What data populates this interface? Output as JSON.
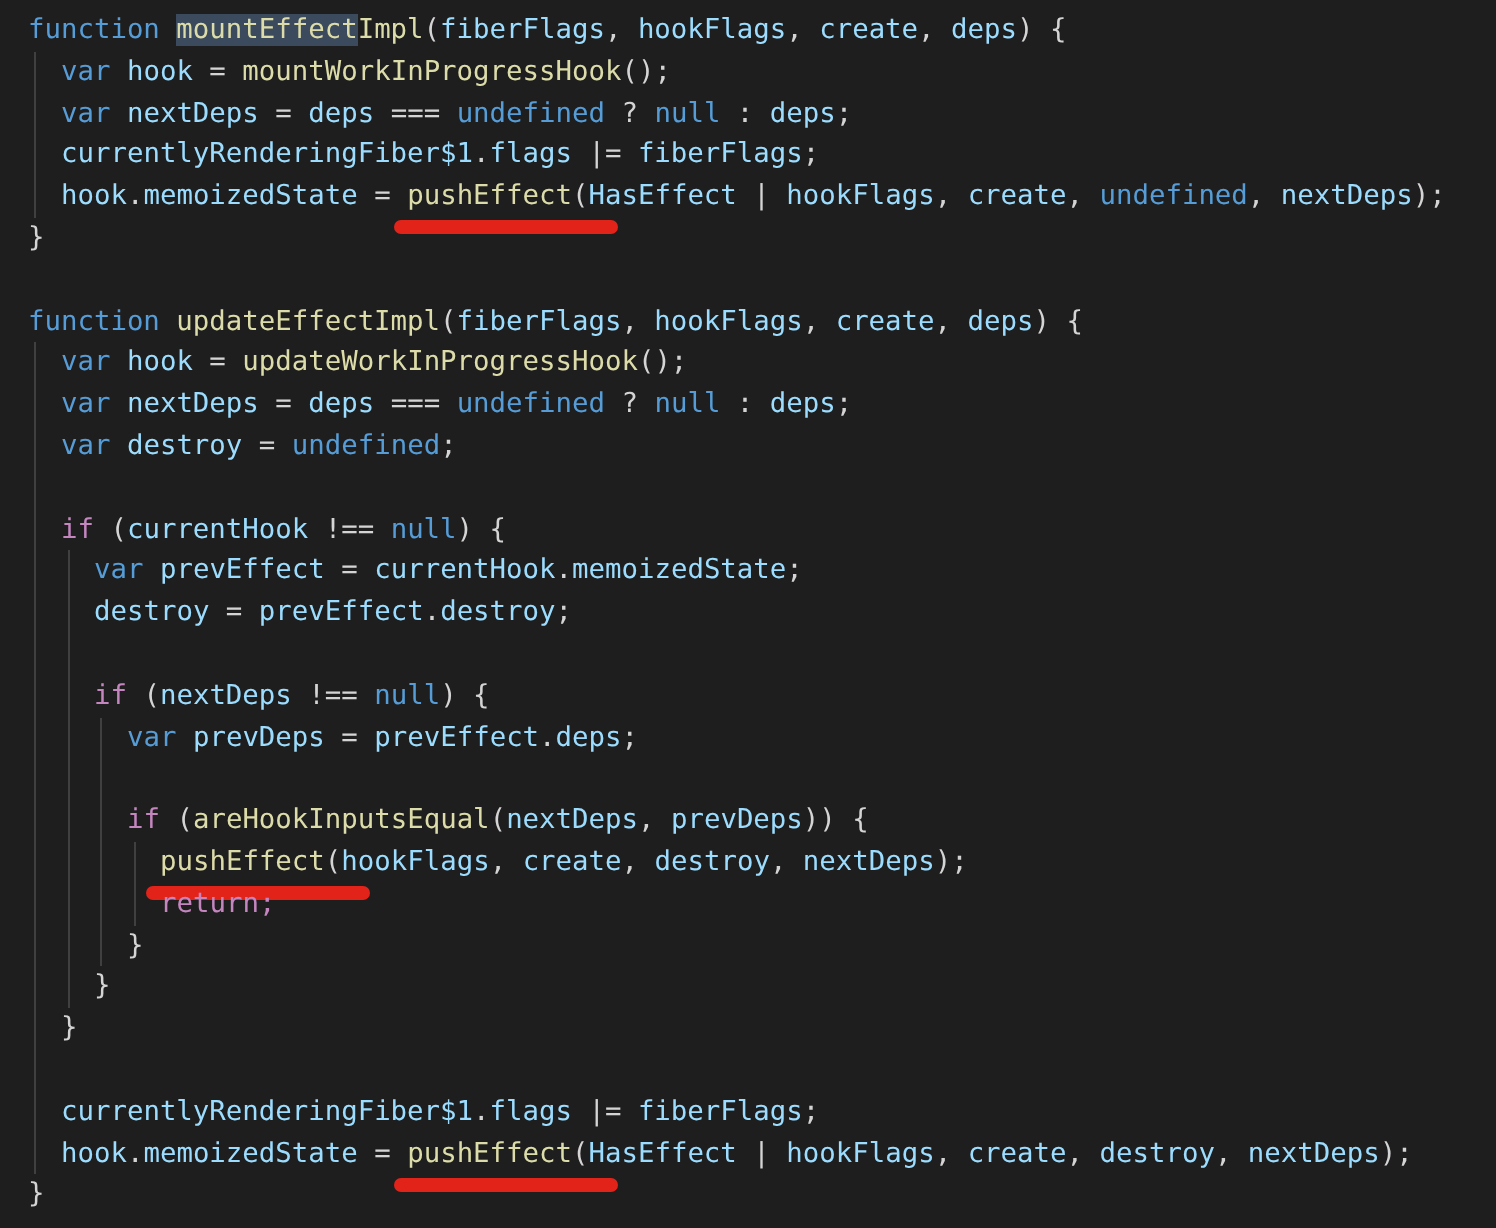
{
  "lines": [
    {
      "kind": "code",
      "tokens": [
        {
          "t": "function ",
          "kind": "kw",
          "highlighted": false,
          "underlined": false
        },
        {
          "t": "mountEffect",
          "kind": "fn",
          "highlighted": true,
          "underlined": false
        },
        {
          "t": "Impl",
          "kind": "fn",
          "highlighted": false,
          "underlined": false
        },
        {
          "t": "(",
          "kind": "op",
          "highlighted": false,
          "underlined": false
        },
        {
          "t": "fiberFlags",
          "kind": "id",
          "highlighted": false,
          "underlined": false
        },
        {
          "t": ", ",
          "kind": "op",
          "highlighted": false,
          "underlined": false
        },
        {
          "t": "hookFlags",
          "kind": "id",
          "highlighted": false,
          "underlined": false
        },
        {
          "t": ", ",
          "kind": "op",
          "highlighted": false,
          "underlined": false
        },
        {
          "t": "create",
          "kind": "id",
          "highlighted": false,
          "underlined": false
        },
        {
          "t": ", ",
          "kind": "op",
          "highlighted": false,
          "underlined": false
        },
        {
          "t": "deps",
          "kind": "id",
          "highlighted": false,
          "underlined": false
        },
        {
          "t": ") {",
          "kind": "op",
          "highlighted": false,
          "underlined": false
        }
      ],
      "children": [
        {
          "kind": "code",
          "tokens": [
            {
              "t": "var ",
              "kind": "kw",
              "highlighted": false,
              "underlined": false
            },
            {
              "t": "hook",
              "kind": "id",
              "highlighted": false,
              "underlined": false
            },
            {
              "t": " = ",
              "kind": "op",
              "highlighted": false,
              "underlined": false
            },
            {
              "t": "mountWorkInProgressHook",
              "kind": "fn",
              "highlighted": false,
              "underlined": false
            },
            {
              "t": "();",
              "kind": "op",
              "highlighted": false,
              "underlined": false
            }
          ]
        },
        {
          "kind": "code",
          "tokens": [
            {
              "t": "var ",
              "kind": "kw",
              "highlighted": false,
              "underlined": false
            },
            {
              "t": "nextDeps",
              "kind": "id",
              "highlighted": false,
              "underlined": false
            },
            {
              "t": " = ",
              "kind": "op",
              "highlighted": false,
              "underlined": false
            },
            {
              "t": "deps",
              "kind": "id",
              "highlighted": false,
              "underlined": false
            },
            {
              "t": " === ",
              "kind": "op",
              "highlighted": false,
              "underlined": false
            },
            {
              "t": "undefined",
              "kind": "kw",
              "highlighted": false,
              "underlined": false
            },
            {
              "t": " ? ",
              "kind": "op",
              "highlighted": false,
              "underlined": false
            },
            {
              "t": "null",
              "kind": "kw",
              "highlighted": false,
              "underlined": false
            },
            {
              "t": " : ",
              "kind": "op",
              "highlighted": false,
              "underlined": false
            },
            {
              "t": "deps",
              "kind": "id",
              "highlighted": false,
              "underlined": false
            },
            {
              "t": ";",
              "kind": "op",
              "highlighted": false,
              "underlined": false
            }
          ]
        },
        {
          "kind": "code",
          "tokens": [
            {
              "t": "currentlyRenderingFiber$1",
              "kind": "id",
              "highlighted": false,
              "underlined": false
            },
            {
              "t": ".",
              "kind": "op",
              "highlighted": false,
              "underlined": false
            },
            {
              "t": "flags",
              "kind": "id",
              "highlighted": false,
              "underlined": false
            },
            {
              "t": " |= ",
              "kind": "op",
              "highlighted": false,
              "underlined": false
            },
            {
              "t": "fiberFlags",
              "kind": "id",
              "highlighted": false,
              "underlined": false
            },
            {
              "t": ";",
              "kind": "op",
              "highlighted": false,
              "underlined": false
            }
          ]
        },
        {
          "kind": "code",
          "tokens": [
            {
              "t": "hook",
              "kind": "id",
              "highlighted": false,
              "underlined": false
            },
            {
              "t": ".",
              "kind": "op",
              "highlighted": false,
              "underlined": false
            },
            {
              "t": "memoizedState",
              "kind": "id",
              "highlighted": false,
              "underlined": false
            },
            {
              "t": " = ",
              "kind": "op",
              "highlighted": false,
              "underlined": false
            },
            {
              "t": "pushEffect",
              "kind": "fn",
              "highlighted": false,
              "underlined": true
            },
            {
              "t": "(",
              "kind": "op",
              "highlighted": false,
              "underlined": false
            },
            {
              "t": "HasEffect",
              "kind": "id",
              "highlighted": false,
              "underlined": false
            },
            {
              "t": " | ",
              "kind": "op",
              "highlighted": false,
              "underlined": false
            },
            {
              "t": "hookFlags",
              "kind": "id",
              "highlighted": false,
              "underlined": false
            },
            {
              "t": ", ",
              "kind": "op",
              "highlighted": false,
              "underlined": false
            },
            {
              "t": "create",
              "kind": "id",
              "highlighted": false,
              "underlined": false
            },
            {
              "t": ", ",
              "kind": "op",
              "highlighted": false,
              "underlined": false
            },
            {
              "t": "undefined",
              "kind": "kw",
              "highlighted": false,
              "underlined": false
            },
            {
              "t": ", ",
              "kind": "op",
              "highlighted": false,
              "underlined": false
            },
            {
              "t": "nextDeps",
              "kind": "id",
              "highlighted": false,
              "underlined": false
            },
            {
              "t": ");",
              "kind": "op",
              "highlighted": false,
              "underlined": false
            }
          ]
        }
      ]
    },
    {
      "kind": "code",
      "tokens": [
        {
          "t": "}",
          "kind": "op",
          "highlighted": false,
          "underlined": false
        }
      ]
    },
    {
      "kind": "blank"
    },
    {
      "kind": "code",
      "tokens": [
        {
          "t": "function ",
          "kind": "kw",
          "highlighted": false,
          "underlined": false
        },
        {
          "t": "updateEffectImpl",
          "kind": "fn",
          "highlighted": false,
          "underlined": false
        },
        {
          "t": "(",
          "kind": "op",
          "highlighted": false,
          "underlined": false
        },
        {
          "t": "fiberFlags",
          "kind": "id",
          "highlighted": false,
          "underlined": false
        },
        {
          "t": ", ",
          "kind": "op",
          "highlighted": false,
          "underlined": false
        },
        {
          "t": "hookFlags",
          "kind": "id",
          "highlighted": false,
          "underlined": false
        },
        {
          "t": ", ",
          "kind": "op",
          "highlighted": false,
          "underlined": false
        },
        {
          "t": "create",
          "kind": "id",
          "highlighted": false,
          "underlined": false
        },
        {
          "t": ", ",
          "kind": "op",
          "highlighted": false,
          "underlined": false
        },
        {
          "t": "deps",
          "kind": "id",
          "highlighted": false,
          "underlined": false
        },
        {
          "t": ") {",
          "kind": "op",
          "highlighted": false,
          "underlined": false
        }
      ],
      "children": [
        {
          "kind": "code",
          "tokens": [
            {
              "t": "var ",
              "kind": "kw",
              "highlighted": false,
              "underlined": false
            },
            {
              "t": "hook",
              "kind": "id",
              "highlighted": false,
              "underlined": false
            },
            {
              "t": " = ",
              "kind": "op",
              "highlighted": false,
              "underlined": false
            },
            {
              "t": "updateWorkInProgressHook",
              "kind": "fn",
              "highlighted": false,
              "underlined": false
            },
            {
              "t": "();",
              "kind": "op",
              "highlighted": false,
              "underlined": false
            }
          ]
        },
        {
          "kind": "code",
          "tokens": [
            {
              "t": "var ",
              "kind": "kw",
              "highlighted": false,
              "underlined": false
            },
            {
              "t": "nextDeps",
              "kind": "id",
              "highlighted": false,
              "underlined": false
            },
            {
              "t": " = ",
              "kind": "op",
              "highlighted": false,
              "underlined": false
            },
            {
              "t": "deps",
              "kind": "id",
              "highlighted": false,
              "underlined": false
            },
            {
              "t": " === ",
              "kind": "op",
              "highlighted": false,
              "underlined": false
            },
            {
              "t": "undefined",
              "kind": "kw",
              "highlighted": false,
              "underlined": false
            },
            {
              "t": " ? ",
              "kind": "op",
              "highlighted": false,
              "underlined": false
            },
            {
              "t": "null",
              "kind": "kw",
              "highlighted": false,
              "underlined": false
            },
            {
              "t": " : ",
              "kind": "op",
              "highlighted": false,
              "underlined": false
            },
            {
              "t": "deps",
              "kind": "id",
              "highlighted": false,
              "underlined": false
            },
            {
              "t": ";",
              "kind": "op",
              "highlighted": false,
              "underlined": false
            }
          ]
        },
        {
          "kind": "code",
          "tokens": [
            {
              "t": "var ",
              "kind": "kw",
              "highlighted": false,
              "underlined": false
            },
            {
              "t": "destroy",
              "kind": "id",
              "highlighted": false,
              "underlined": false
            },
            {
              "t": " = ",
              "kind": "op",
              "highlighted": false,
              "underlined": false
            },
            {
              "t": "undefined",
              "kind": "kw",
              "highlighted": false,
              "underlined": false
            },
            {
              "t": ";",
              "kind": "op",
              "highlighted": false,
              "underlined": false
            }
          ]
        },
        {
          "kind": "blank"
        },
        {
          "kind": "code",
          "tokens": [
            {
              "t": "if",
              "kind": "ctl",
              "highlighted": false,
              "underlined": false
            },
            {
              "t": " (",
              "kind": "op",
              "highlighted": false,
              "underlined": false
            },
            {
              "t": "currentHook",
              "kind": "id",
              "highlighted": false,
              "underlined": false
            },
            {
              "t": " !== ",
              "kind": "op",
              "highlighted": false,
              "underlined": false
            },
            {
              "t": "null",
              "kind": "kw",
              "highlighted": false,
              "underlined": false
            },
            {
              "t": ") {",
              "kind": "op",
              "highlighted": false,
              "underlined": false
            }
          ],
          "children": [
            {
              "kind": "code",
              "tokens": [
                {
                  "t": "var ",
                  "kind": "kw",
                  "highlighted": false,
                  "underlined": false
                },
                {
                  "t": "prevEffect",
                  "kind": "id",
                  "highlighted": false,
                  "underlined": false
                },
                {
                  "t": " = ",
                  "kind": "op",
                  "highlighted": false,
                  "underlined": false
                },
                {
                  "t": "currentHook",
                  "kind": "id",
                  "highlighted": false,
                  "underlined": false
                },
                {
                  "t": ".",
                  "kind": "op",
                  "highlighted": false,
                  "underlined": false
                },
                {
                  "t": "memoizedState",
                  "kind": "id",
                  "highlighted": false,
                  "underlined": false
                },
                {
                  "t": ";",
                  "kind": "op",
                  "highlighted": false,
                  "underlined": false
                }
              ]
            },
            {
              "kind": "code",
              "tokens": [
                {
                  "t": "destroy",
                  "kind": "id",
                  "highlighted": false,
                  "underlined": false
                },
                {
                  "t": " = ",
                  "kind": "op",
                  "highlighted": false,
                  "underlined": false
                },
                {
                  "t": "prevEffect",
                  "kind": "id",
                  "highlighted": false,
                  "underlined": false
                },
                {
                  "t": ".",
                  "kind": "op",
                  "highlighted": false,
                  "underlined": false
                },
                {
                  "t": "destroy",
                  "kind": "id",
                  "highlighted": false,
                  "underlined": false
                },
                {
                  "t": ";",
                  "kind": "op",
                  "highlighted": false,
                  "underlined": false
                }
              ]
            },
            {
              "kind": "blank"
            },
            {
              "kind": "code",
              "tokens": [
                {
                  "t": "if",
                  "kind": "ctl",
                  "highlighted": false,
                  "underlined": false
                },
                {
                  "t": " (",
                  "kind": "op",
                  "highlighted": false,
                  "underlined": false
                },
                {
                  "t": "nextDeps",
                  "kind": "id",
                  "highlighted": false,
                  "underlined": false
                },
                {
                  "t": " !== ",
                  "kind": "op",
                  "highlighted": false,
                  "underlined": false
                },
                {
                  "t": "null",
                  "kind": "kw",
                  "highlighted": false,
                  "underlined": false
                },
                {
                  "t": ") {",
                  "kind": "op",
                  "highlighted": false,
                  "underlined": false
                }
              ],
              "children": [
                {
                  "kind": "code",
                  "tokens": [
                    {
                      "t": "var ",
                      "kind": "kw",
                      "highlighted": false,
                      "underlined": false
                    },
                    {
                      "t": "prevDeps",
                      "kind": "id",
                      "highlighted": false,
                      "underlined": false
                    },
                    {
                      "t": " = ",
                      "kind": "op",
                      "highlighted": false,
                      "underlined": false
                    },
                    {
                      "t": "prevEffect",
                      "kind": "id",
                      "highlighted": false,
                      "underlined": false
                    },
                    {
                      "t": ".",
                      "kind": "op",
                      "highlighted": false,
                      "underlined": false
                    },
                    {
                      "t": "deps",
                      "kind": "id",
                      "highlighted": false,
                      "underlined": false
                    },
                    {
                      "t": ";",
                      "kind": "op",
                      "highlighted": false,
                      "underlined": false
                    }
                  ]
                },
                {
                  "kind": "blank"
                },
                {
                  "kind": "code",
                  "tokens": [
                    {
                      "t": "if",
                      "kind": "ctl",
                      "highlighted": false,
                      "underlined": false
                    },
                    {
                      "t": " (",
                      "kind": "op",
                      "highlighted": false,
                      "underlined": false
                    },
                    {
                      "t": "areHookInputsEqual",
                      "kind": "fn",
                      "highlighted": false,
                      "underlined": false
                    },
                    {
                      "t": "(",
                      "kind": "op",
                      "highlighted": false,
                      "underlined": false
                    },
                    {
                      "t": "nextDeps",
                      "kind": "id",
                      "highlighted": false,
                      "underlined": false
                    },
                    {
                      "t": ", ",
                      "kind": "op",
                      "highlighted": false,
                      "underlined": false
                    },
                    {
                      "t": "prevDeps",
                      "kind": "id",
                      "highlighted": false,
                      "underlined": false
                    },
                    {
                      "t": ")) {",
                      "kind": "op",
                      "highlighted": false,
                      "underlined": false
                    }
                  ],
                  "children": [
                    {
                      "kind": "code",
                      "tokens": [
                        {
                          "t": "pushEffect",
                          "kind": "fn",
                          "highlighted": false,
                          "underlined": true
                        },
                        {
                          "t": "(",
                          "kind": "op",
                          "highlighted": false,
                          "underlined": false
                        },
                        {
                          "t": "hookFlags",
                          "kind": "id",
                          "highlighted": false,
                          "underlined": false
                        },
                        {
                          "t": ", ",
                          "kind": "op",
                          "highlighted": false,
                          "underlined": false
                        },
                        {
                          "t": "create",
                          "kind": "id",
                          "highlighted": false,
                          "underlined": false
                        },
                        {
                          "t": ", ",
                          "kind": "op",
                          "highlighted": false,
                          "underlined": false
                        },
                        {
                          "t": "destroy",
                          "kind": "id",
                          "highlighted": false,
                          "underlined": false
                        },
                        {
                          "t": ", ",
                          "kind": "op",
                          "highlighted": false,
                          "underlined": false
                        },
                        {
                          "t": "nextDeps",
                          "kind": "id",
                          "highlighted": false,
                          "underlined": false
                        },
                        {
                          "t": ");",
                          "kind": "op",
                          "highlighted": false,
                          "underlined": false
                        }
                      ]
                    },
                    {
                      "kind": "code",
                      "tokens": [
                        {
                          "t": "return;",
                          "kind": "ctl",
                          "highlighted": false,
                          "underlined": false
                        }
                      ]
                    }
                  ]
                },
                {
                  "kind": "code",
                  "tokens": [
                    {
                      "t": "}",
                      "kind": "op",
                      "highlighted": false,
                      "underlined": false
                    }
                  ]
                }
              ]
            },
            {
              "kind": "code",
              "tokens": [
                {
                  "t": "}",
                  "kind": "op",
                  "highlighted": false,
                  "underlined": false
                }
              ]
            }
          ]
        },
        {
          "kind": "code",
          "tokens": [
            {
              "t": "}",
              "kind": "op",
              "highlighted": false,
              "underlined": false
            }
          ]
        },
        {
          "kind": "blank"
        },
        {
          "kind": "code",
          "tokens": [
            {
              "t": "currentlyRenderingFiber$1",
              "kind": "id",
              "highlighted": false,
              "underlined": false
            },
            {
              "t": ".",
              "kind": "op",
              "highlighted": false,
              "underlined": false
            },
            {
              "t": "flags",
              "kind": "id",
              "highlighted": false,
              "underlined": false
            },
            {
              "t": " |= ",
              "kind": "op",
              "highlighted": false,
              "underlined": false
            },
            {
              "t": "fiberFlags",
              "kind": "id",
              "highlighted": false,
              "underlined": false
            },
            {
              "t": ";",
              "kind": "op",
              "highlighted": false,
              "underlined": false
            }
          ]
        },
        {
          "kind": "code",
          "tokens": [
            {
              "t": "hook",
              "kind": "id",
              "highlighted": false,
              "underlined": false
            },
            {
              "t": ".",
              "kind": "op",
              "highlighted": false,
              "underlined": false
            },
            {
              "t": "memoizedState",
              "kind": "id",
              "highlighted": false,
              "underlined": false
            },
            {
              "t": " = ",
              "kind": "op",
              "highlighted": false,
              "underlined": false
            },
            {
              "t": "pushEffect",
              "kind": "fn",
              "highlighted": false,
              "underlined": true
            },
            {
              "t": "(",
              "kind": "op",
              "highlighted": false,
              "underlined": false
            },
            {
              "t": "HasEffect",
              "kind": "id",
              "highlighted": false,
              "underlined": false
            },
            {
              "t": " | ",
              "kind": "op",
              "highlighted": false,
              "underlined": false
            },
            {
              "t": "hookFlags",
              "kind": "id",
              "highlighted": false,
              "underlined": false
            },
            {
              "t": ", ",
              "kind": "op",
              "highlighted": false,
              "underlined": false
            },
            {
              "t": "create",
              "kind": "id",
              "highlighted": false,
              "underlined": false
            },
            {
              "t": ", ",
              "kind": "op",
              "highlighted": false,
              "underlined": false
            },
            {
              "t": "destroy",
              "kind": "id",
              "highlighted": false,
              "underlined": false
            },
            {
              "t": ", ",
              "kind": "op",
              "highlighted": false,
              "underlined": false
            },
            {
              "t": "nextDeps",
              "kind": "id",
              "highlighted": false,
              "underlined": false
            },
            {
              "t": ");",
              "kind": "op",
              "highlighted": false,
              "underlined": false
            }
          ]
        }
      ]
    },
    {
      "kind": "code",
      "tokens": [
        {
          "t": "}",
          "kind": "op",
          "highlighted": false,
          "underlined": false
        }
      ]
    }
  ]
}
